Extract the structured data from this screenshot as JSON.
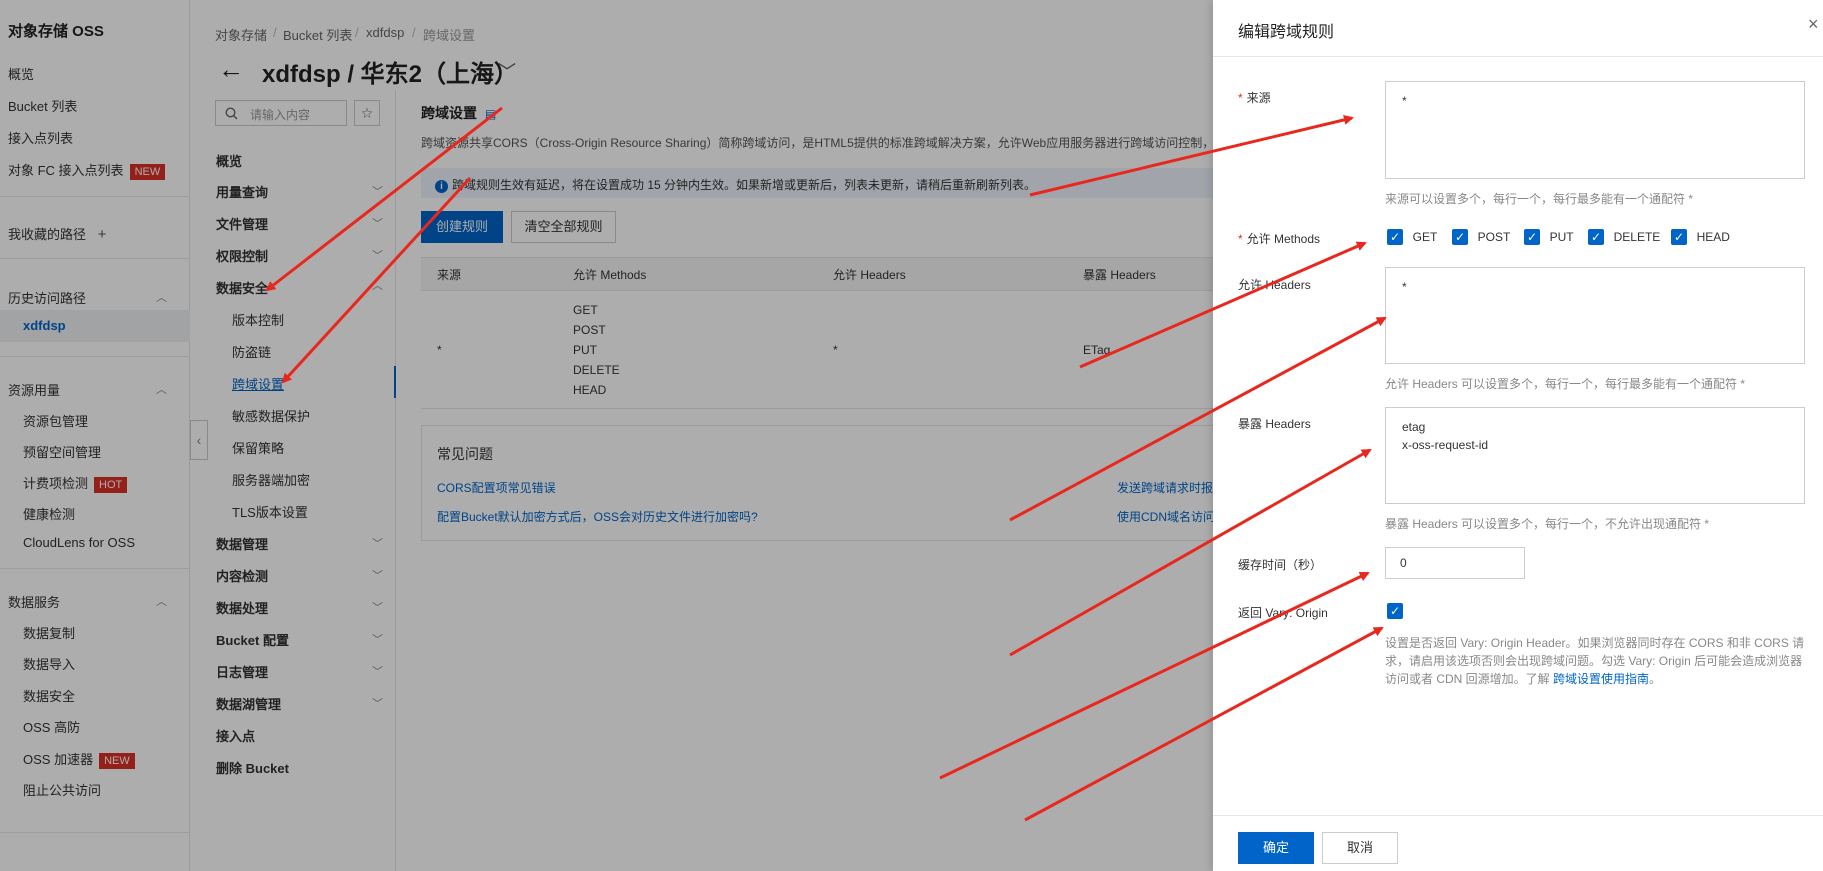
{
  "left_nav": {
    "title": "对象存储 OSS",
    "items": {
      "overview": "概览",
      "bucket_list": "Bucket 列表",
      "access_points": "接入点列表",
      "fc_access_points": "对象 FC 接入点列表",
      "fc_badge": "NEW",
      "favorites": "我收藏的路径",
      "favorites_add": "+",
      "history": "历史访问路径",
      "history_item": "xdfdsp",
      "resource_usage": "资源用量",
      "resource_pkg": "资源包管理",
      "reserved_space": "预留空间管理",
      "billing_check": "计费项检测",
      "billing_badge": "HOT",
      "health_check": "健康检测",
      "cloudlens": "CloudLens for OSS",
      "data_services": "数据服务",
      "data_replication": "数据复制",
      "data_import": "数据导入",
      "data_security": "数据安全",
      "oss_ddos": "OSS 高防",
      "oss_accelerator": "OSS 加速器",
      "accelerator_badge": "NEW",
      "block_public": "阻止公共访问"
    }
  },
  "breadcrumb": [
    "对象存储",
    "Bucket 列表",
    "xdfdsp",
    "跨域设置"
  ],
  "page_title": "xdfdsp / 华东2（上海）",
  "sec_nav": {
    "search_placeholder": "请输入内容",
    "items": {
      "overview": "概览",
      "usage_query": "用量查询",
      "file_mgmt": "文件管理",
      "permission": "权限控制",
      "data_security": "数据安全",
      "versioning": "版本控制",
      "hotlink": "防盗链",
      "cors": "跨域设置",
      "sensitive": "敏感数据保护",
      "retention": "保留策略",
      "sse": "服务器端加密",
      "tls": "TLS版本设置",
      "data_mgmt": "数据管理",
      "content_detect": "内容检测",
      "data_processing": "数据处理",
      "bucket_config": "Bucket 配置",
      "log_mgmt": "日志管理",
      "datalake": "数据湖管理",
      "access_point": "接入点",
      "delete_bucket": "删除 Bucket"
    }
  },
  "main": {
    "section_title": "跨域设置",
    "description": "跨域资源共享CORS（Cross-Origin Resource Sharing）简称跨域访问，是HTML5提供的标准跨域解决方案，允许Web应用服务器进行跨域访问控制，确",
    "info": "跨域规则生效有延迟，将在设置成功 15 分钟内生效。如果新增或更新后，列表未更新，请稍后重新刷新列表。",
    "create_button": "创建规则",
    "clear_button": "清空全部规则",
    "table": {
      "headers": [
        "来源",
        "允许 Methods",
        "允许 Headers",
        "暴露 Headers"
      ],
      "row": {
        "origin": "*",
        "methods": [
          "GET",
          "POST",
          "PUT",
          "DELETE",
          "HEAD"
        ],
        "allow_headers": "*",
        "expose_headers": "ETag"
      }
    },
    "faq": {
      "title": "常见问题",
      "links": [
        "CORS配置项常见错误",
        "配置Bucket默认加密方式后，OSS会对历史文件进行加密吗?",
        "发送跨域请求时报",
        "使用CDN域名访问"
      ]
    }
  },
  "drawer": {
    "title": "编辑跨域规则",
    "close": "×",
    "origin_label": "来源",
    "origin_value": "*",
    "origin_help": "来源可以设置多个，每行一个，每行最多能有一个通配符 *",
    "methods_label": "允许 Methods",
    "methods": [
      "GET",
      "POST",
      "PUT",
      "DELETE",
      "HEAD"
    ],
    "allow_headers_label": "允许 Headers",
    "allow_headers_value": "*",
    "allow_headers_help": "允许 Headers 可以设置多个，每行一个，每行最多能有一个通配符 *",
    "expose_headers_label": "暴露 Headers",
    "expose_headers_lines": [
      "etag",
      "x-oss-request-id"
    ],
    "expose_headers_help": "暴露 Headers 可以设置多个，每行一个，不允许出现通配符 *",
    "cache_label": "缓存时间（秒）",
    "cache_value": "0",
    "vary_label": "返回 Vary: Origin",
    "vary_help": "设置是否返回 Vary: Origin Header。如果浏览器同时存在 CORS 和非 CORS 请求，请启用该选项否则会出现跨域问题。勾选 Vary: Origin 后可能会造成浏览器访问或者 CDN 回源增加。了解",
    "vary_link": "跨域设置使用指南",
    "vary_link_suffix": "。",
    "ok_button": "确定",
    "cancel_button": "取消"
  },
  "colors": {
    "primary": "#0064c8",
    "annotation_arrow": "#e8281e",
    "badge_red": "#d93026"
  }
}
